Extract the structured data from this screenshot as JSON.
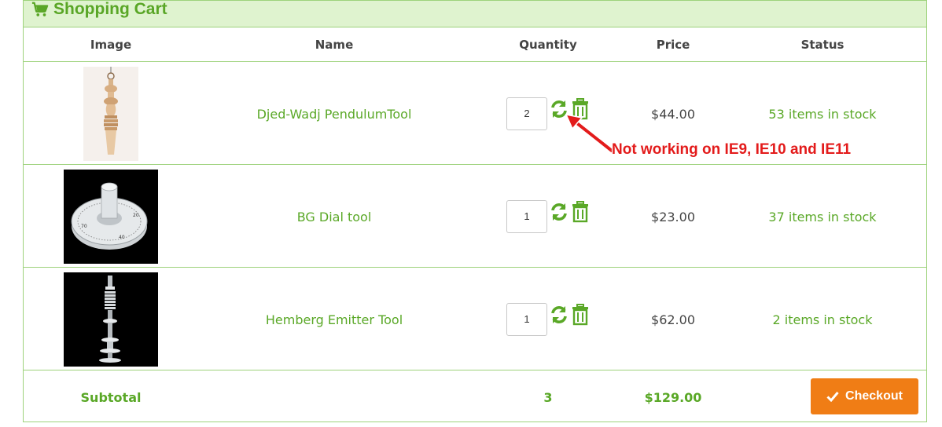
{
  "panel": {
    "title": "Shopping Cart",
    "icon": "shopping-cart-icon"
  },
  "columns": [
    "Image",
    "Name",
    "Quantity",
    "Price",
    "Status"
  ],
  "items": [
    {
      "name": "Djed-Wadj PendulumTool",
      "quantity": "2",
      "price": "$44.00",
      "status": "53 items in stock"
    },
    {
      "name": "BG Dial tool",
      "quantity": "1",
      "price": "$23.00",
      "status": "37 items in stock"
    },
    {
      "name": "Hemberg Emitter Tool",
      "quantity": "1",
      "price": "$62.00",
      "status": "2 items in stock"
    }
  ],
  "annotation": "Not working on IE9, IE10 and IE11",
  "summary": {
    "label": "Subtotal",
    "quantity": "3",
    "total": "$129.00"
  },
  "checkout": {
    "label": "Checkout"
  },
  "colors": {
    "accent": "#59a626",
    "header_bg": "#dff3cf",
    "checkout": "#f07d15",
    "annotation": "#e31b1b"
  }
}
